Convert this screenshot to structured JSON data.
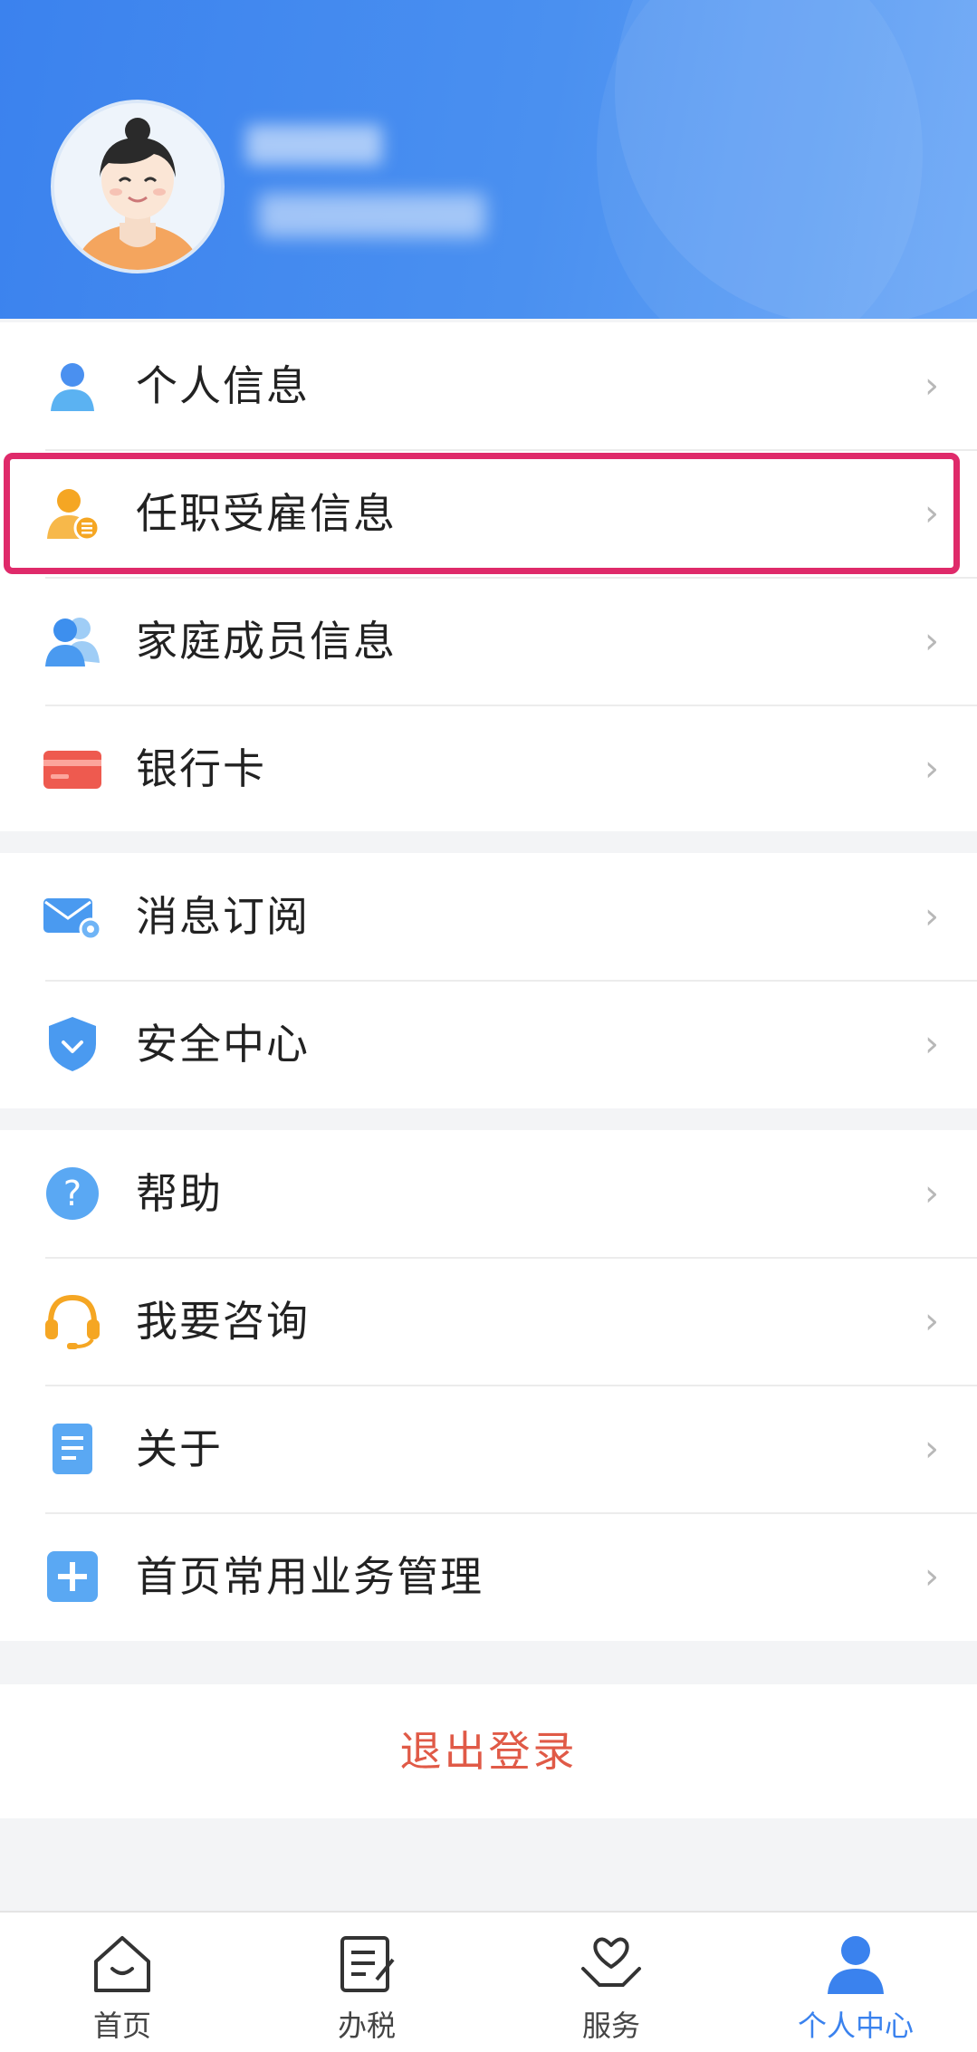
{
  "profile": {
    "avatar_icon": "user-avatar-woman",
    "name_redacted": true
  },
  "menu_group_1": [
    {
      "label": "个人信息",
      "icon": "person-icon"
    },
    {
      "label": "任职受雇信息",
      "icon": "employment-icon",
      "highlighted": true
    },
    {
      "label": "家庭成员信息",
      "icon": "family-icon"
    },
    {
      "label": "银行卡",
      "icon": "bank-card-icon"
    }
  ],
  "menu_group_2": [
    {
      "label": "消息订阅",
      "icon": "mail-settings-icon"
    },
    {
      "label": "安全中心",
      "icon": "shield-icon"
    }
  ],
  "menu_group_3": [
    {
      "label": "帮助",
      "icon": "help-icon"
    },
    {
      "label": "我要咨询",
      "icon": "headset-icon"
    },
    {
      "label": "关于",
      "icon": "document-icon"
    },
    {
      "label": "首页常用业务管理",
      "icon": "plus-icon"
    }
  ],
  "chevron": "›",
  "logout_label": "退出登录",
  "tabs": [
    {
      "label": "首页",
      "icon": "home-icon"
    },
    {
      "label": "办税",
      "icon": "tax-form-icon"
    },
    {
      "label": "服务",
      "icon": "heart-hands-icon"
    },
    {
      "label": "个人中心",
      "icon": "person-center-icon",
      "active": true
    }
  ],
  "colors": {
    "header_blue": "#4a90f0",
    "accent_blue": "#3a82ee",
    "highlight": "#df2a6a",
    "logout_red": "#e05a47"
  }
}
